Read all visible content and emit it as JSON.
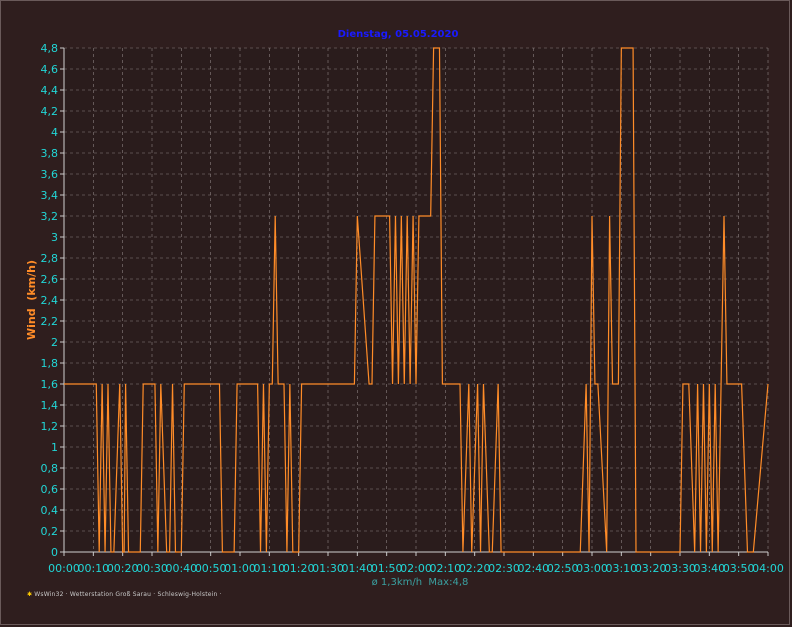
{
  "colors": {
    "background": "#2f1e1e",
    "plot_background": "#2a1c1c",
    "grid": "#8c8080",
    "line": "#ff8c28",
    "title": "#1a1aff",
    "ylabel": "#ff8c28",
    "ticks": "#22d6d6",
    "summary": "#3aa0a0"
  },
  "footer": {
    "icon": "gear-icon",
    "text": "WsWin32 · Wetterstation Groß Sarau · Schleswig-Holstein ·"
  },
  "chart_data": {
    "type": "line",
    "title": "Dienstag, 05.05.2020",
    "xlabel": "",
    "ylabel": "Wind  (km/h)",
    "summary": "ø 1,3km/h  Max:4,8",
    "xlim": [
      0,
      240
    ],
    "ylim": [
      0,
      4.8
    ],
    "grid": true,
    "x_ticks": [
      "00:00",
      "00:10",
      "00:20",
      "00:30",
      "00:40",
      "00:50",
      "01:00",
      "01:10",
      "01:20",
      "01:30",
      "01:40",
      "01:50",
      "02:00",
      "02:10",
      "02:20",
      "02:30",
      "02:40",
      "02:50",
      "03:00",
      "03:10",
      "03:20",
      "03:30",
      "03:40",
      "03:50",
      "04:00"
    ],
    "y_ticks": [
      "0",
      "0,2",
      "0,4",
      "0,6",
      "0,8",
      "1",
      "1,2",
      "1,4",
      "1,6",
      "1,8",
      "2",
      "2,2",
      "2,4",
      "2,6",
      "2,8",
      "3",
      "3,2",
      "3,4",
      "3,6",
      "3,8",
      "4",
      "4,2",
      "4,4",
      "4,6",
      "4,8"
    ],
    "series": [
      {
        "x": [
          0,
          11,
          12,
          13,
          14,
          15,
          16,
          17,
          19,
          20,
          20.5,
          21,
          22,
          26,
          27,
          29,
          31,
          32,
          33,
          35,
          36,
          37,
          38,
          40,
          41,
          43,
          53,
          54,
          58,
          59,
          64,
          66,
          67,
          68,
          69,
          70,
          71,
          72,
          73,
          75,
          76,
          77,
          78,
          80,
          81,
          81.5,
          82,
          87,
          88,
          95,
          96,
          98,
          99,
          100,
          104,
          105,
          106,
          107,
          108,
          109,
          110,
          111,
          112,
          113,
          114,
          115,
          116,
          117,
          118,
          119,
          120,
          121,
          122,
          125,
          126,
          128,
          129,
          134,
          135,
          136,
          138,
          139,
          141,
          142,
          143,
          145,
          146,
          148,
          149,
          151,
          152,
          154,
          162,
          163,
          165,
          172,
          173,
          174,
          175,
          176,
          178,
          179,
          180,
          181,
          182,
          185,
          186,
          187,
          189,
          190,
          194,
          195,
          200,
          201,
          208,
          209,
          210,
          211,
          212,
          213,
          215,
          216,
          217,
          218,
          219,
          220,
          221,
          222,
          223,
          224,
          225,
          226,
          230,
          231,
          233,
          234,
          235,
          240
        ],
        "y": [
          1.6,
          1.6,
          0,
          1.6,
          0,
          1.6,
          0,
          0,
          1.6,
          0,
          0,
          1.6,
          0,
          0,
          1.6,
          1.6,
          1.6,
          0,
          1.6,
          0,
          0,
          1.6,
          0,
          0,
          1.6,
          1.6,
          1.6,
          0,
          0,
          1.6,
          1.6,
          1.6,
          0,
          1.6,
          0,
          1.6,
          1.6,
          3.2,
          1.6,
          1.6,
          0,
          1.6,
          0,
          0,
          1.6,
          1.6,
          1.6,
          1.6,
          1.6,
          1.6,
          1.6,
          1.6,
          1.6,
          3.2,
          1.6,
          1.6,
          3.2,
          3.2,
          3.2,
          3.2,
          3.2,
          3.2,
          1.6,
          3.2,
          1.6,
          3.2,
          1.6,
          3.2,
          1.6,
          3.2,
          1.6,
          3.2,
          3.2,
          3.2,
          4.8,
          4.8,
          1.6,
          1.6,
          1.6,
          0,
          1.6,
          0,
          1.6,
          0,
          1.6,
          0,
          0,
          1.6,
          0,
          0,
          0,
          0,
          0,
          0,
          0,
          0,
          0,
          0,
          0,
          0,
          1.6,
          0,
          3.2,
          1.6,
          1.6,
          0,
          3.2,
          1.6,
          1.6,
          4.8,
          4.8,
          0,
          0,
          0,
          0,
          0,
          0,
          1.6,
          1.6,
          1.6,
          0,
          1.6,
          0,
          1.6,
          0,
          1.6,
          0,
          1.6,
          0,
          1.6,
          3.2,
          1.6,
          1.6,
          1.6,
          0,
          0,
          0,
          1.6
        ]
      }
    ]
  }
}
